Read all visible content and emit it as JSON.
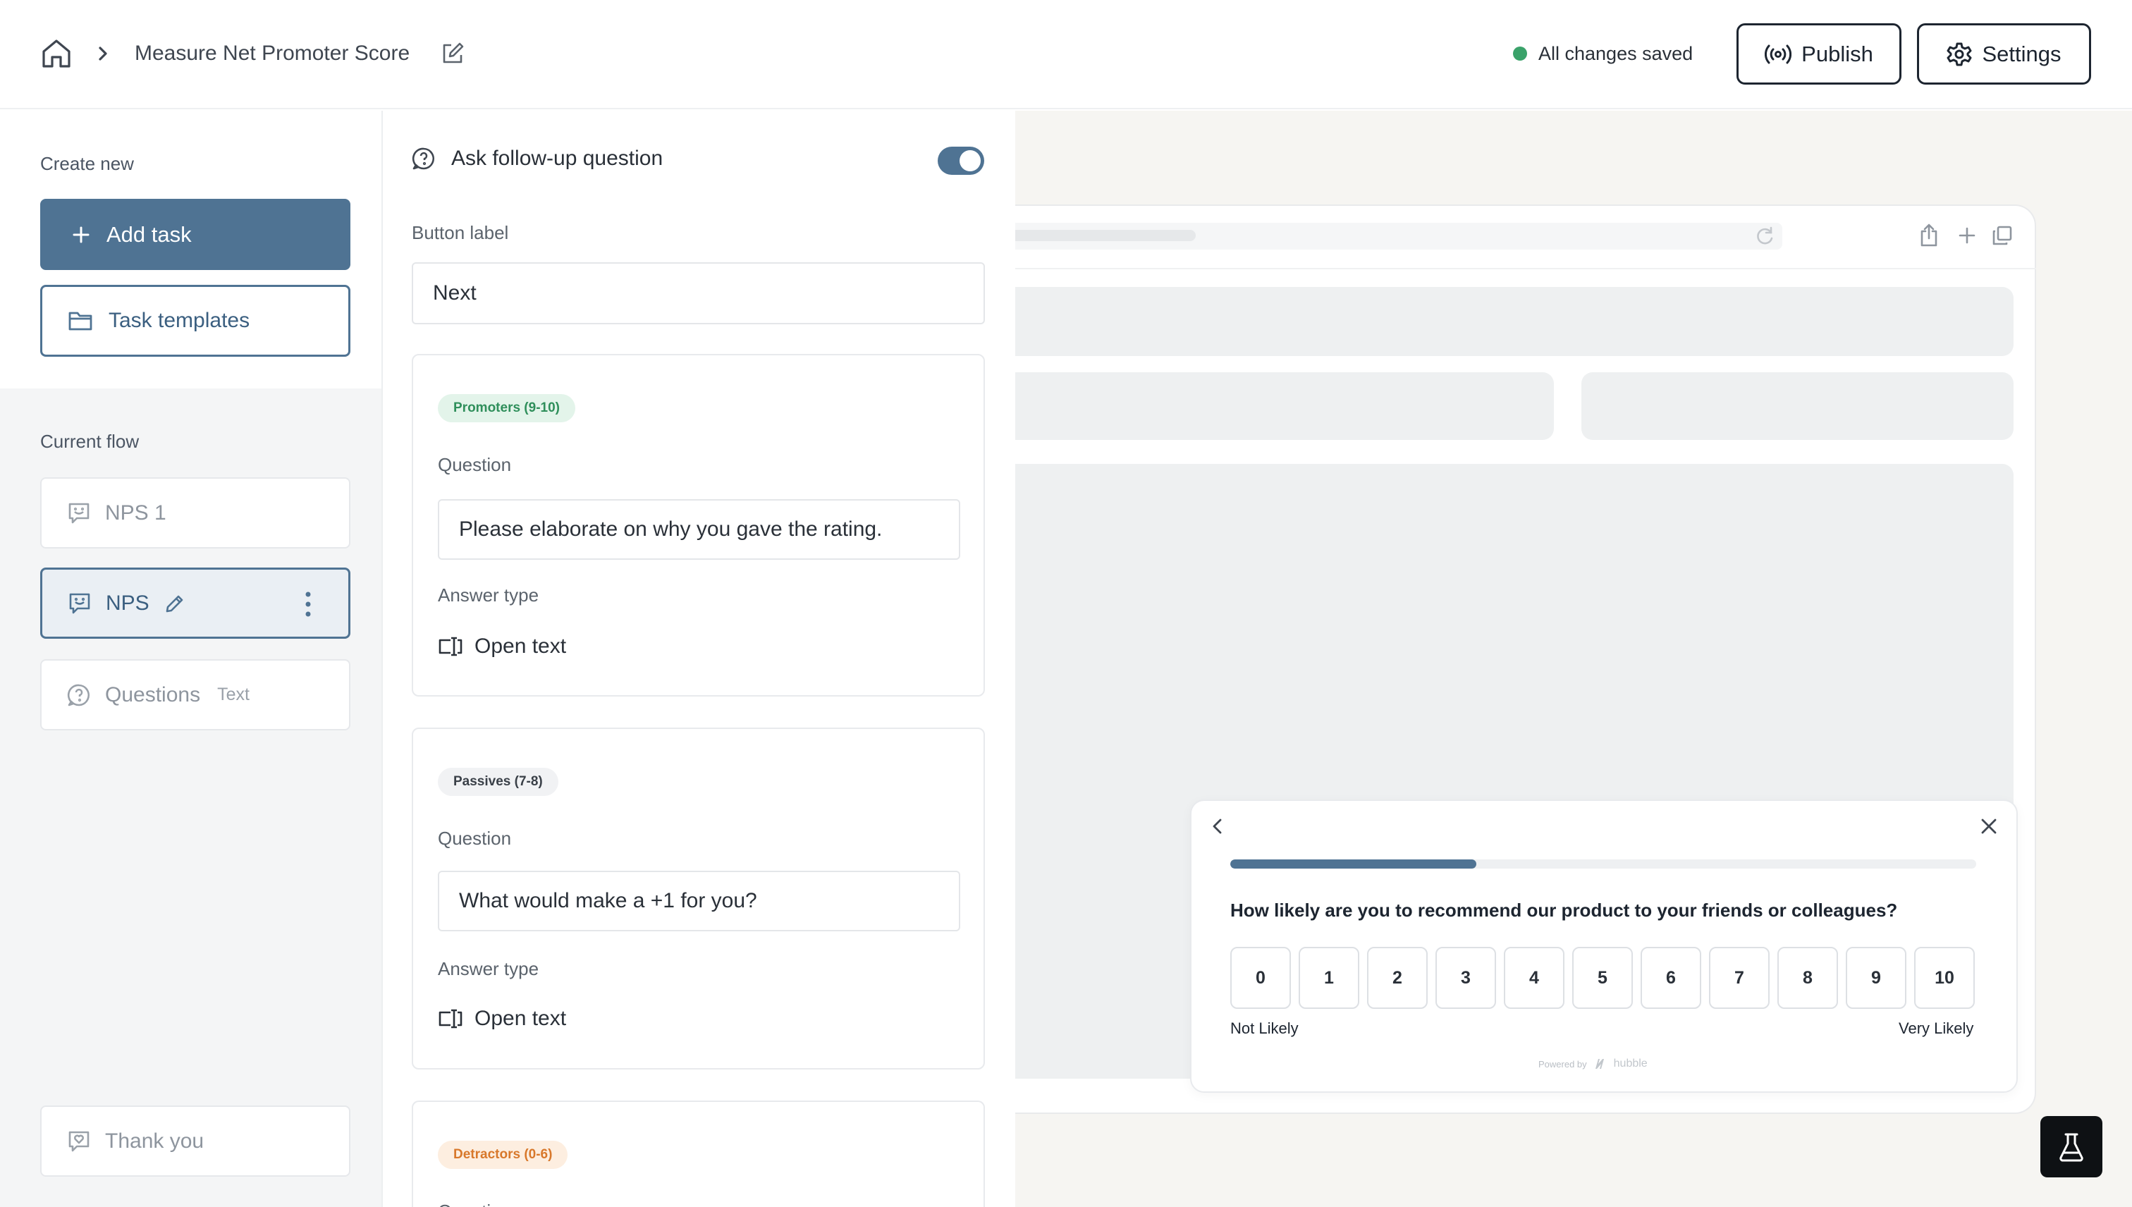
{
  "header": {
    "breadcrumb_title": "Measure Net Promoter Score",
    "status_text": "All changes saved",
    "status_color": "#3aa26a",
    "publish_label": "Publish",
    "settings_label": "Settings"
  },
  "sidebar": {
    "create_new_label": "Create new",
    "add_task_label": "Add task",
    "task_templates_label": "Task templates",
    "current_flow_label": "Current flow",
    "flow_items": [
      {
        "label": "NPS 1",
        "sub": ""
      },
      {
        "label": "NPS",
        "sub": ""
      },
      {
        "label": "Questions",
        "sub": "Text"
      }
    ],
    "thank_you_label": "Thank you",
    "accent_color": "#4f7393"
  },
  "editor": {
    "follow_up_label": "Ask follow-up question",
    "follow_up_enabled": true,
    "button_label_title": "Button label",
    "button_label_value": "Next",
    "cards": [
      {
        "badge": "Promoters (9-10)",
        "question_label": "Question",
        "question_value": "Please elaborate on why you gave the rating.",
        "answer_type_label": "Answer type",
        "answer_type_value": "Open text"
      },
      {
        "badge": "Passives (7-8)",
        "question_label": "Question",
        "question_value": "What would make a +1 for you?",
        "answer_type_label": "Answer type",
        "answer_type_value": "Open text"
      },
      {
        "badge": "Detractors (0-6)",
        "question_label": "Question"
      }
    ]
  },
  "preview": {
    "widget": {
      "progress": 0.33,
      "question": "How likely are you to recommend our product to your friends or colleagues?",
      "scale": [
        "0",
        "1",
        "2",
        "3",
        "4",
        "5",
        "6",
        "7",
        "8",
        "9",
        "10"
      ],
      "low_label": "Not Likely",
      "high_label": "Very Likely",
      "powered_by": "Powered by",
      "brand": "hubble"
    }
  }
}
